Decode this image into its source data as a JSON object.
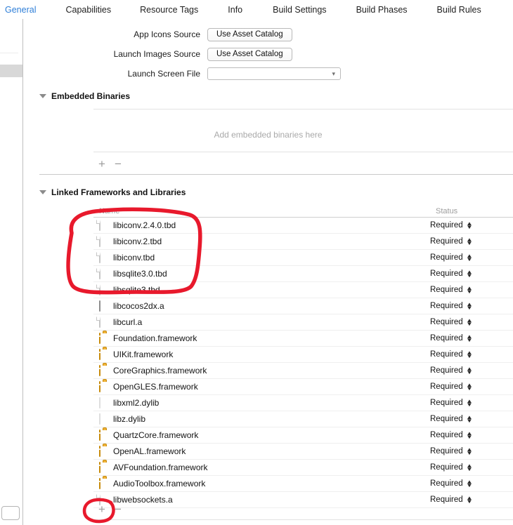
{
  "tabs": [
    {
      "label": "General",
      "active": true
    },
    {
      "label": "Capabilities",
      "active": false
    },
    {
      "label": "Resource Tags",
      "active": false
    },
    {
      "label": "Info",
      "active": false
    },
    {
      "label": "Build Settings",
      "active": false
    },
    {
      "label": "Build Phases",
      "active": false
    },
    {
      "label": "Build Rules",
      "active": false
    }
  ],
  "form": {
    "app_icons_label": "App Icons Source",
    "app_icons_button": "Use Asset Catalog",
    "launch_images_label": "Launch Images Source",
    "launch_images_button": "Use Asset Catalog",
    "launch_screen_label": "Launch Screen File",
    "launch_screen_value": ""
  },
  "embedded_binaries": {
    "title": "Embedded Binaries",
    "empty_text": "Add embedded binaries here",
    "add_label": "+",
    "remove_label": "−"
  },
  "linked_frameworks": {
    "title": "Linked Frameworks and Libraries",
    "columns": {
      "name": "Name",
      "status": "Status"
    },
    "add_label": "+",
    "remove_label": "−",
    "rows": [
      {
        "name": "libiconv.2.4.0.tbd",
        "icon": "document-icon",
        "status": "Required"
      },
      {
        "name": "libiconv.2.tbd",
        "icon": "document-icon",
        "status": "Required"
      },
      {
        "name": "libiconv.tbd",
        "icon": "document-icon",
        "status": "Required"
      },
      {
        "name": "libsqlite3.0.tbd",
        "icon": "document-icon",
        "status": "Required"
      },
      {
        "name": "libsqlite3.tbd",
        "icon": "document-icon",
        "status": "Required"
      },
      {
        "name": "libcocos2dx.a",
        "icon": "archive-icon",
        "status": "Required"
      },
      {
        "name": "libcurl.a",
        "icon": "document-icon",
        "status": "Required"
      },
      {
        "name": "Foundation.framework",
        "icon": "framework-icon",
        "status": "Required"
      },
      {
        "name": "UIKit.framework",
        "icon": "framework-icon",
        "status": "Required"
      },
      {
        "name": "CoreGraphics.framework",
        "icon": "framework-icon",
        "status": "Required"
      },
      {
        "name": "OpenGLES.framework",
        "icon": "framework-icon",
        "status": "Required"
      },
      {
        "name": "libxml2.dylib",
        "icon": "dylib-icon",
        "status": "Required"
      },
      {
        "name": "libz.dylib",
        "icon": "dylib-icon",
        "status": "Required"
      },
      {
        "name": "QuartzCore.framework",
        "icon": "framework-icon",
        "status": "Required"
      },
      {
        "name": "OpenAL.framework",
        "icon": "framework-icon",
        "status": "Required"
      },
      {
        "name": "AVFoundation.framework",
        "icon": "framework-icon",
        "status": "Required"
      },
      {
        "name": "AudioToolbox.framework",
        "icon": "framework-icon",
        "status": "Required"
      },
      {
        "name": "libwebsockets.a",
        "icon": "document-icon",
        "status": "Required"
      }
    ]
  },
  "annotations": {
    "color": "#e8192c",
    "oval_rows": "highlights libiconv.2.4.0.tbd through libsqlite3.tbd",
    "circle_add": "highlights the add button below the linked frameworks list"
  },
  "colors": {
    "active_tab": "#2f7fd8",
    "framework_icon": "#e29f16",
    "annotation_red": "#e8192c"
  }
}
